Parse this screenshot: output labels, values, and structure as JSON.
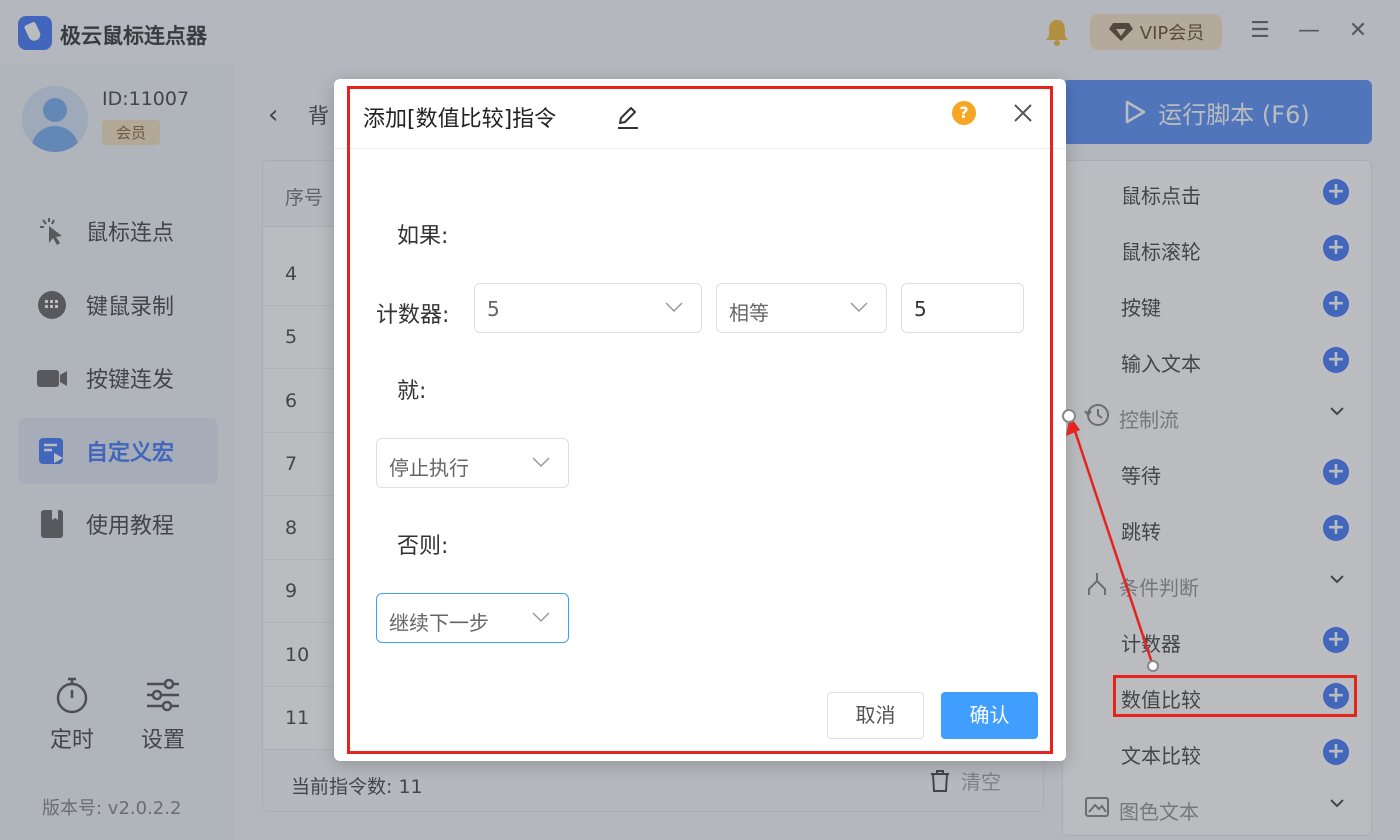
{
  "app": {
    "title": "极云鼠标连点器",
    "vip_label": "VIP会员"
  },
  "user": {
    "id_text": "ID:11007",
    "badge": "会员"
  },
  "sidebar": {
    "items": [
      {
        "label": "鼠标连点",
        "icon": "cursor-click-icon"
      },
      {
        "label": "键鼠录制",
        "icon": "keyboard-icon"
      },
      {
        "label": "按键连发",
        "icon": "camera-icon"
      },
      {
        "label": "自定义宏",
        "icon": "macro-icon",
        "active": true
      },
      {
        "label": "使用教程",
        "icon": "book-icon"
      }
    ],
    "timer_label": "定时",
    "settings_label": "设置",
    "version": "版本号: v2.0.2.2"
  },
  "main": {
    "header_title": "背",
    "column_header": "序号",
    "rows": [
      "4",
      "5",
      "6",
      "7",
      "8",
      "9",
      "10",
      "11"
    ],
    "count_text": "当前指令数: 11",
    "clear_label": "清空"
  },
  "run_button": {
    "label": "运行脚本 (F6)"
  },
  "commands": {
    "mouse_click": "鼠标点击",
    "mouse_wheel": "鼠标滚轮",
    "key": "按键",
    "input_text": "输入文本",
    "control_flow": "控制流",
    "wait": "等待",
    "jump": "跳转",
    "condition": "条件判断",
    "counter": "计数器",
    "value_compare": "数值比较",
    "text_compare": "文本比较",
    "color_text": "图色文本"
  },
  "dialog": {
    "title": "添加[数值比较]指令",
    "if_label": "如果:",
    "counter_label": "计数器:",
    "counter_select": "5",
    "operator_select": "相等",
    "compare_value": "5",
    "then_label": "就:",
    "then_select": "停止执行",
    "else_label": "否则:",
    "else_select": "继续下一步",
    "cancel_label": "取消",
    "confirm_label": "确认",
    "help_glyph": "?"
  },
  "colors": {
    "accent": "#2f6cf6",
    "confirm": "#409eff",
    "annotation": "#e5231f",
    "help": "#f5a623"
  }
}
